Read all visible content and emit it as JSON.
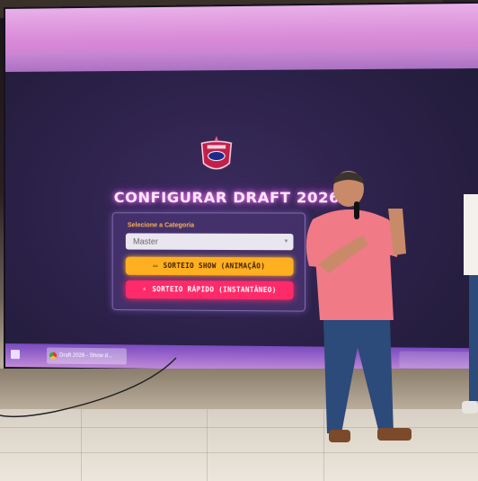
{
  "screen": {
    "title": "CONFIGURAR DRAFT 2026",
    "category_label": "Selecione a Categoria",
    "category_value": "Master",
    "button_animation": "SORTEIO SHOW (ANIMAÇÃO)",
    "button_instant": "SORTEIO RÁPIDO (INSTANTÂNEO)"
  },
  "taskbar": {
    "active_app": "Draft 2026 - Show d..."
  },
  "colors": {
    "title_glow": "#ff7aff",
    "animation_button": "#ffb020",
    "instant_button": "#ff2a6a",
    "panel": "#46326e",
    "screen_bg": "#2a2046"
  },
  "icons": [
    "team-crest-icon",
    "monitor-icon",
    "lightning-icon",
    "chrome-icon",
    "windows-start-icon"
  ]
}
